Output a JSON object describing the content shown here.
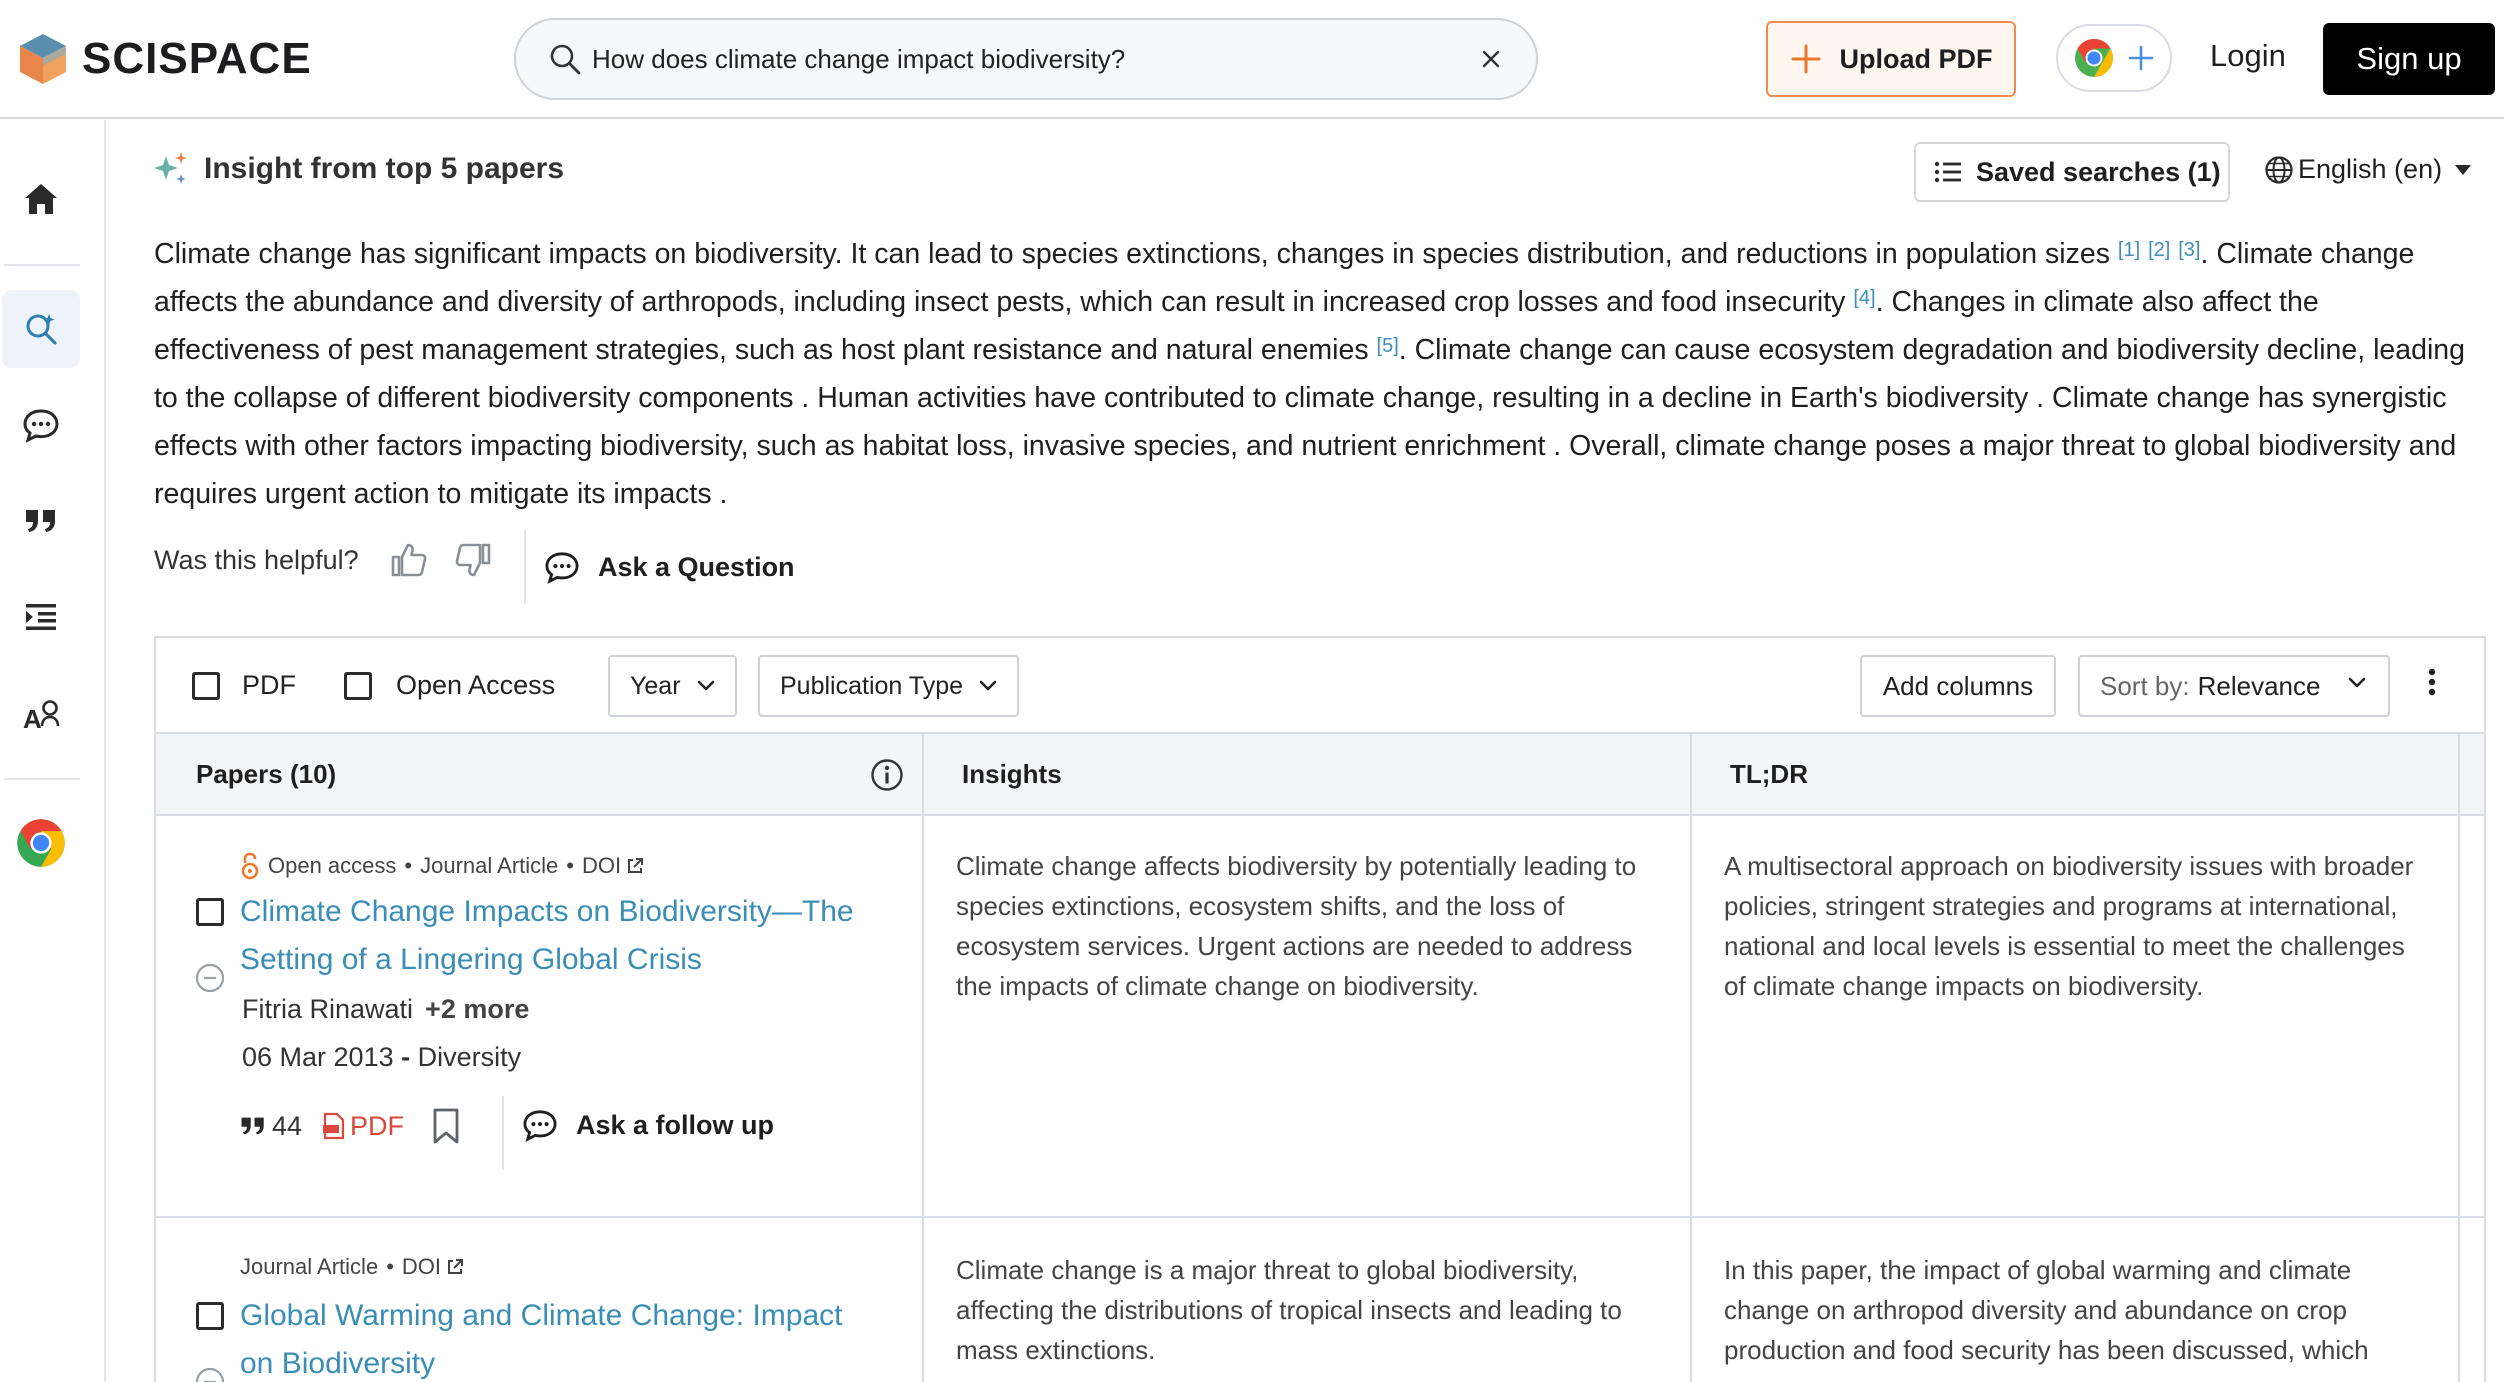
{
  "header": {
    "logo_text": "SCISPACE",
    "search": {
      "value": "How does climate change impact biodiversity?"
    },
    "upload_label": "Upload PDF",
    "login_label": "Login",
    "signup_label": "Sign up"
  },
  "sidebar": {
    "items": [
      {
        "name": "home",
        "icon": "home-icon",
        "active": false
      },
      {
        "name": "search",
        "icon": "literature-search-icon",
        "active": true
      },
      {
        "name": "chat",
        "icon": "chat-icon",
        "active": false
      },
      {
        "name": "citations",
        "icon": "quote-icon",
        "active": false
      },
      {
        "name": "outline",
        "icon": "indent-list-icon",
        "active": false
      },
      {
        "name": "ai-writer",
        "icon": "ai-detect-icon",
        "active": false
      },
      {
        "name": "chrome-extension",
        "icon": "chrome-icon",
        "active": false
      }
    ]
  },
  "insight": {
    "title": "Insight from top 5 papers",
    "saved_searches": "Saved searches (1)",
    "language": "English (en)",
    "summary": {
      "p1": "Climate change has significant impacts on biodiversity. It can lead to species extinctions, changes in species distribution, and reductions in population sizes ",
      "r1": "[1]",
      "r2": "[2]",
      "r3": "[3]",
      "p2": ". Climate change affects the abundance and diversity of arthropods, including insect pests, which can result in increased crop losses and food insecurity ",
      "r4": "[4]",
      "p3": ". Changes in climate also affect the effectiveness of pest management strategies, such as host plant resistance and natural enemies ",
      "r5": "[5]",
      "p4": ". Climate change can cause ecosystem degradation and biodiversity decline, leading to the collapse of different biodiversity components . Human activities have contributed to climate change, resulting in a decline in Earth's biodiversity . Climate change has synergistic effects with other factors impacting biodiversity, such as habitat loss, invasive species, and nutrient enrichment . Overall, climate change poses a major threat to global biodiversity and requires urgent action to mitigate its impacts ."
    },
    "helpful_label": "Was this helpful?",
    "ask_label": "Ask a Question"
  },
  "filters": {
    "pdf_label": "PDF",
    "open_access_label": "Open Access",
    "year_label": "Year",
    "pubtype_label": "Publication Type",
    "add_columns_label": "Add columns",
    "sort_prefix": "Sort by:",
    "sort_value": "Relevance"
  },
  "table": {
    "headers": {
      "papers": "Papers (10)",
      "insights": "Insights",
      "tldr": "TL;DR"
    },
    "rows": [
      {
        "open_access": "Open access",
        "type": "Journal Article",
        "doi": "DOI",
        "title": "Climate Change Impacts on Biodiversity—The Setting of a Lingering Global Crisis",
        "author": "Fitria Rinawati",
        "more_authors": "+2 more",
        "date": "06 Mar 2013",
        "venue": "Diversity",
        "citations": "44",
        "pdf_label": "PDF",
        "follow_up_label": "Ask a follow up",
        "insight": "Climate change affects biodiversity by potentially leading to species extinctions, ecosystem shifts, and the loss of ecosystem services. Urgent actions are needed to address the impacts of climate change on biodiversity.",
        "tldr": "A multisectoral approach on biodiversity issues with broader policies, stringent strategies and programs at international, national and local levels is essential to meet the challenges of climate change impacts on biodiversity."
      },
      {
        "type": "Journal Article",
        "doi": "DOI",
        "title": "Global Warming and Climate Change: Impact on Biodiversity",
        "insight": "Climate change is a major threat to global biodiversity, affecting the distributions of tropical insects and leading to mass extinctions.",
        "tldr": "In this paper, the impact of global warming and climate change on arthropod diversity and abundance on crop production and food security has been discussed, which"
      }
    ]
  },
  "colors": {
    "accent_link": "#3a8db5",
    "upload_border": "#f28b50",
    "pdf_red": "#d9483b",
    "open_access_orange": "#f07a2d"
  }
}
